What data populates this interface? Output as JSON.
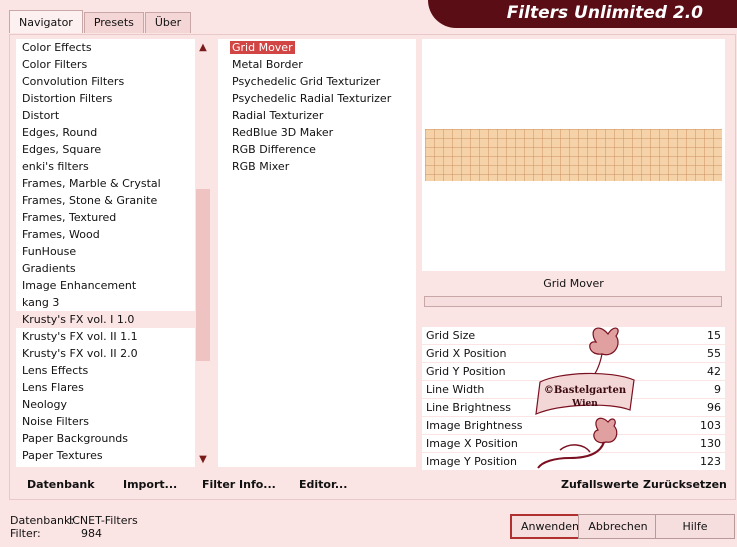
{
  "tabs": [
    {
      "label": "Navigator",
      "active": true
    },
    {
      "label": "Presets",
      "active": false
    },
    {
      "label": "Über",
      "active": false
    }
  ],
  "banner_title": "Filters Unlimited 2.0",
  "categories": [
    "Color Effects",
    "Color Filters",
    "Convolution Filters",
    "Distortion Filters",
    "Distort",
    "Edges, Round",
    "Edges, Square",
    "enki's filters",
    "Frames, Marble & Crystal",
    "Frames, Stone & Granite",
    "Frames, Textured",
    "Frames, Wood",
    "FunHouse",
    "Gradients",
    "Image Enhancement",
    "kang 3",
    "Krusty's FX vol. I 1.0",
    "Krusty's FX vol. II 1.1",
    "Krusty's FX vol. II 2.0",
    "Lens Effects",
    "Lens Flares",
    "Neology",
    "Noise Filters",
    "Paper Backgrounds",
    "Paper Textures"
  ],
  "selected_category": "Krusty's FX vol. I 1.0",
  "filters": [
    "Grid Mover",
    "Metal Border",
    "Psychedelic Grid Texturizer",
    "Psychedelic Radial Texturizer",
    "Radial Texturizer",
    "RedBlue 3D Maker",
    "RGB Difference",
    "RGB Mixer"
  ],
  "selected_filter": "Grid Mover",
  "param_panel_title": "Grid Mover",
  "params": [
    {
      "label": "Grid Size",
      "value": "15"
    },
    {
      "label": "Grid X Position",
      "value": "55"
    },
    {
      "label": "Grid Y Position",
      "value": "42"
    },
    {
      "label": "Line Width",
      "value": "9"
    },
    {
      "label": "Line Brightness",
      "value": "96"
    },
    {
      "label": "Image Brightness",
      "value": "103"
    },
    {
      "label": "Image X Position",
      "value": "130"
    },
    {
      "label": "Image Y Position",
      "value": "123"
    }
  ],
  "watermark": {
    "line1": "©Bastelgarten",
    "line2": "Wien"
  },
  "toolbar": {
    "datenbank": "Datenbank",
    "import": "Import...",
    "filter_info": "Filter Info...",
    "editor": "Editor...",
    "zufallswerte": "Zufallswerte",
    "zuruecksetzen": "Zurücksetzen"
  },
  "status": {
    "datenbank_label": "Datenbank:",
    "datenbank_value": "ICNET-Filters",
    "filter_label": "Filter:",
    "filter_value": "984"
  },
  "buttons": {
    "ok": "Anwenden",
    "cancel": "Abbrechen",
    "help": "Hilfe"
  },
  "colors": {
    "accent": "#d24545",
    "banner": "#5a0d14",
    "background": "#fbe4e4"
  }
}
